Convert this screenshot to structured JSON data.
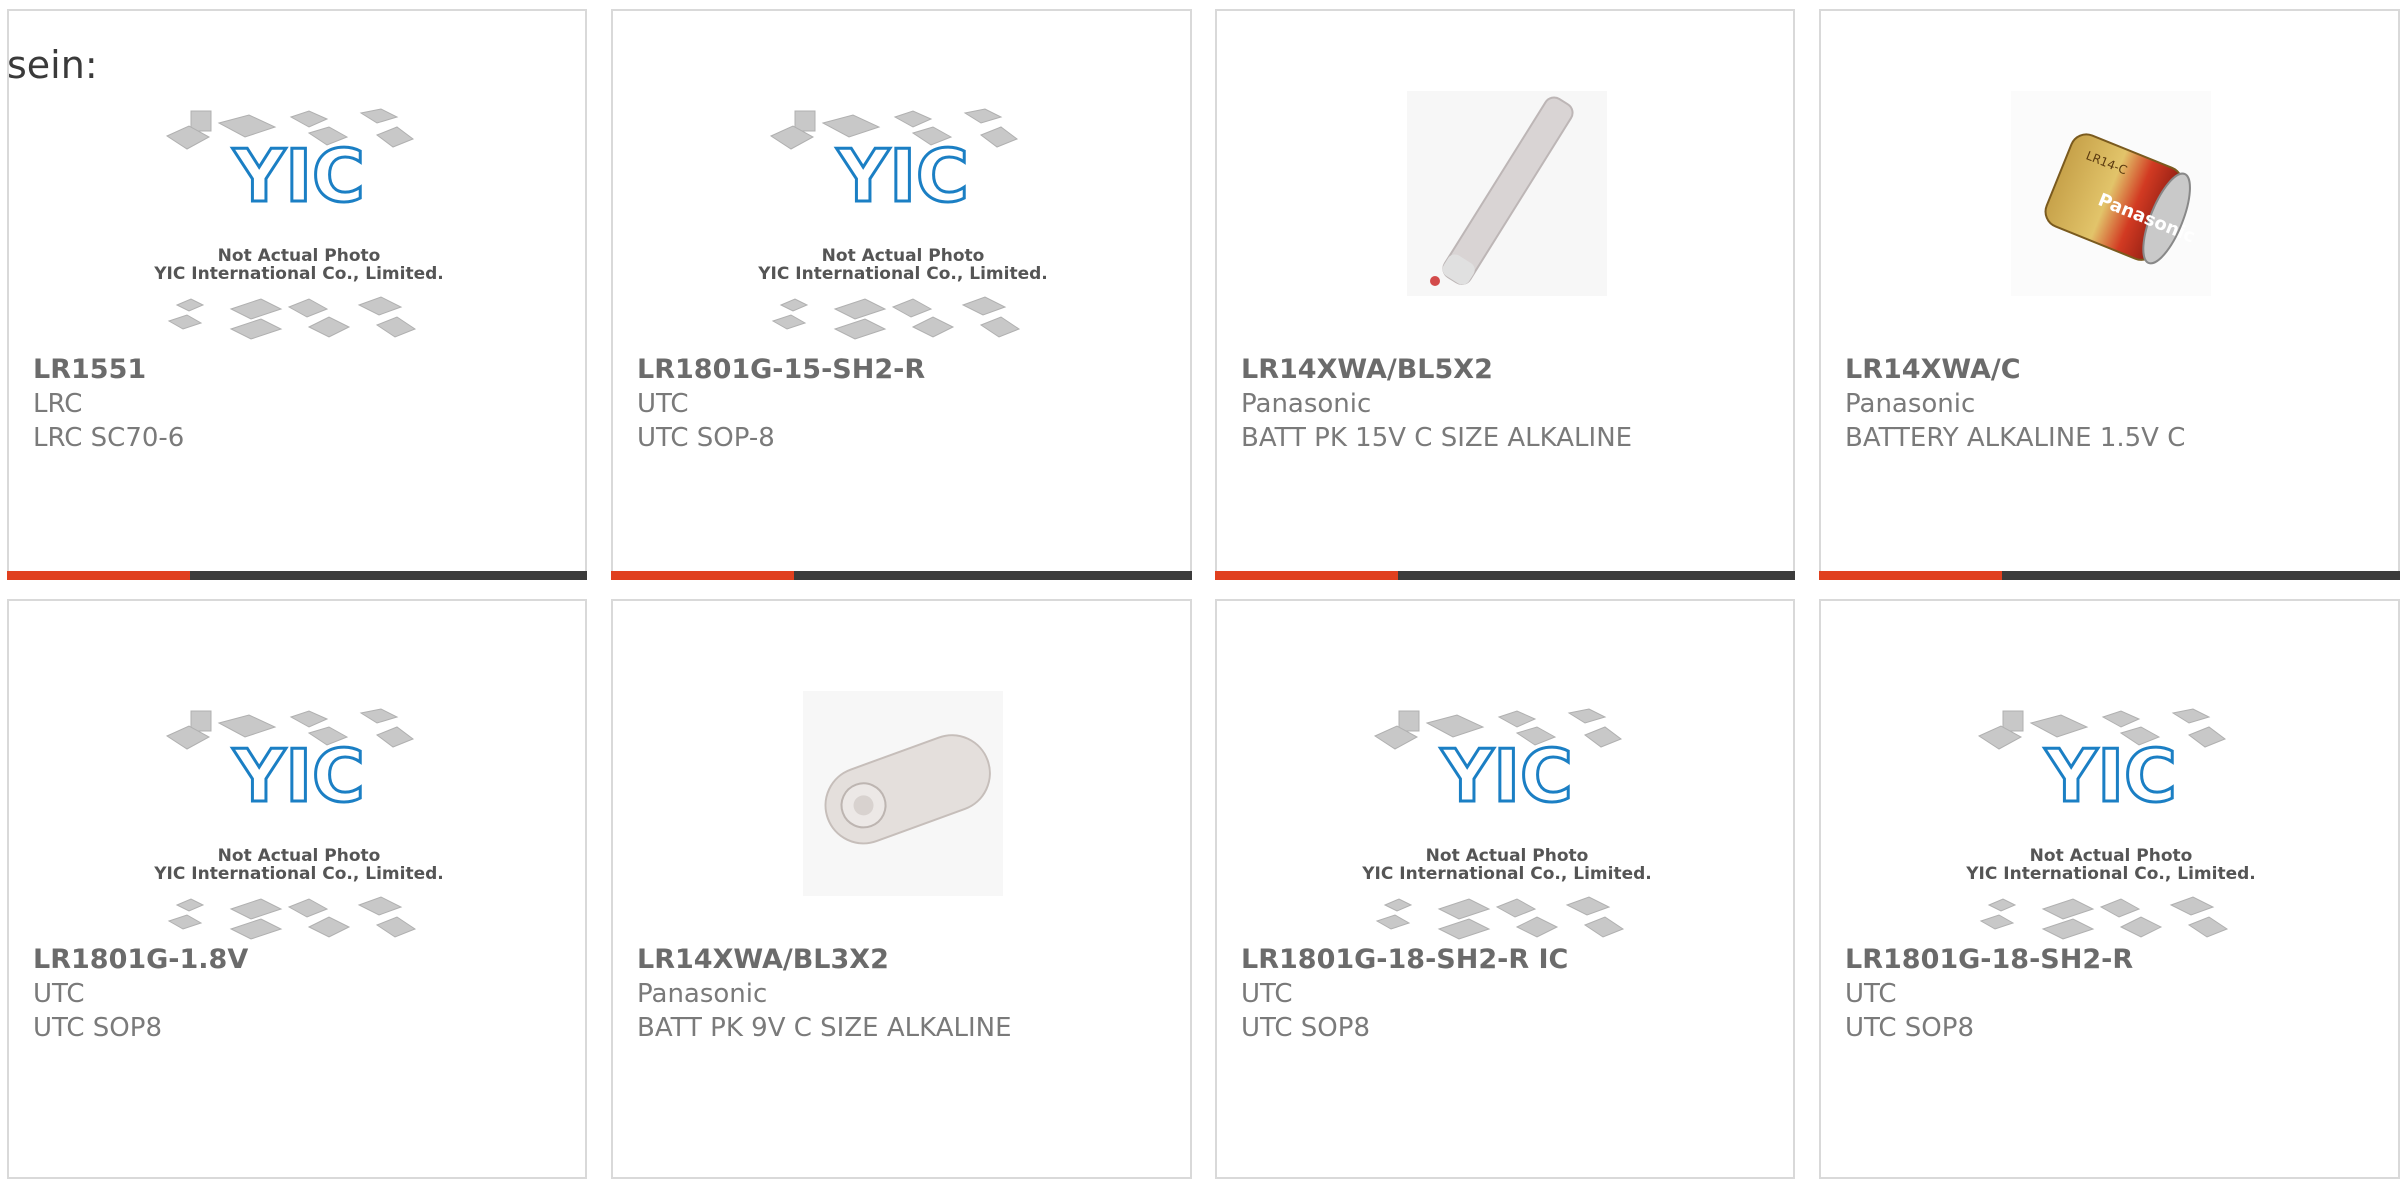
{
  "intro_label": "sein:",
  "placeholder": {
    "line1": "Not Actual Photo",
    "line2": "YIC International Co., Limited."
  },
  "battery_brand": "Panasonic",
  "battery_model": "LR14-C",
  "products": [
    {
      "part": "LR1551",
      "manufacturer": "LRC",
      "description": "LRC SC70-6",
      "image": "yic-placeholder"
    },
    {
      "part": "LR1801G-15-SH2-R",
      "manufacturer": "UTC",
      "description": "UTC SOP-8",
      "image": "yic-placeholder"
    },
    {
      "part": "LR14XWA/BL5X2",
      "manufacturer": "Panasonic",
      "description": "BATT PK 15V C SIZE ALKALINE",
      "image": "battery-stick"
    },
    {
      "part": "LR14XWA/C",
      "manufacturer": "Panasonic",
      "description": "BATTERY ALKALINE 1.5V C",
      "image": "battery-c-cell"
    },
    {
      "part": "LR1801G-1.8V",
      "manufacturer": "UTC",
      "description": "UTC SOP8",
      "image": "yic-placeholder"
    },
    {
      "part": "LR14XWA/BL3X2",
      "manufacturer": "Panasonic",
      "description": "BATT PK 9V C SIZE ALKALINE",
      "image": "battery-pack"
    },
    {
      "part": "LR1801G-18-SH2-R IC",
      "manufacturer": "UTC",
      "description": "UTC SOP8",
      "image": "yic-placeholder"
    },
    {
      "part": "LR1801G-18-SH2-R",
      "manufacturer": "UTC",
      "description": "UTC SOP8",
      "image": "yic-placeholder"
    }
  ],
  "colors": {
    "accent": "#e0401f",
    "bar": "#3b3b3b",
    "logo": "#1b7fc4"
  }
}
